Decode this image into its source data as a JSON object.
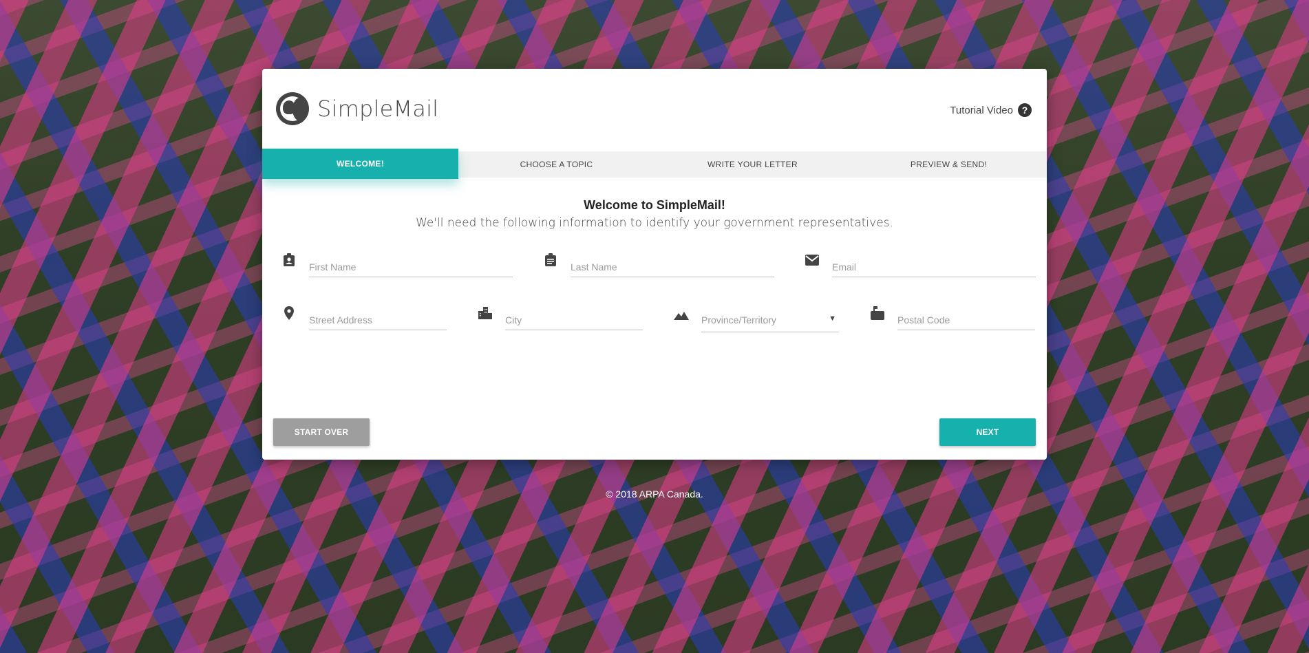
{
  "brand": {
    "name": "SimpleMail"
  },
  "header": {
    "tutorial_label": "Tutorial Video",
    "help_glyph": "?"
  },
  "tabs": [
    {
      "label": "WELCOME!",
      "active": true
    },
    {
      "label": "CHOOSE A TOPIC",
      "active": false
    },
    {
      "label": "WRITE YOUR LETTER",
      "active": false
    },
    {
      "label": "PREVIEW & SEND!",
      "active": false
    }
  ],
  "welcome": {
    "title": "Welcome to SimpleMail!",
    "subtitle": "We'll need the following information to identify your government representatives."
  },
  "form": {
    "first_name": {
      "placeholder": "First Name",
      "value": "",
      "icon": "contact-badge-icon"
    },
    "last_name": {
      "placeholder": "Last Name",
      "value": "",
      "icon": "clipboard-icon"
    },
    "email": {
      "placeholder": "Email",
      "value": "",
      "icon": "mail-icon"
    },
    "street": {
      "placeholder": "Street Address",
      "value": "",
      "icon": "location-pin-icon"
    },
    "city": {
      "placeholder": "City",
      "value": "",
      "icon": "city-icon"
    },
    "province": {
      "placeholder": "Province/Territory",
      "value": "",
      "icon": "mountain-icon"
    },
    "postal": {
      "placeholder": "Postal Code",
      "value": "",
      "icon": "mailbox-icon"
    }
  },
  "buttons": {
    "start_over": "START OVER",
    "next": "NEXT"
  },
  "footer": {
    "copyright": "© 2018 ARPA Canada."
  },
  "colors": {
    "accent": "#16b0ad",
    "secondary_button": "#9e9e9e"
  }
}
